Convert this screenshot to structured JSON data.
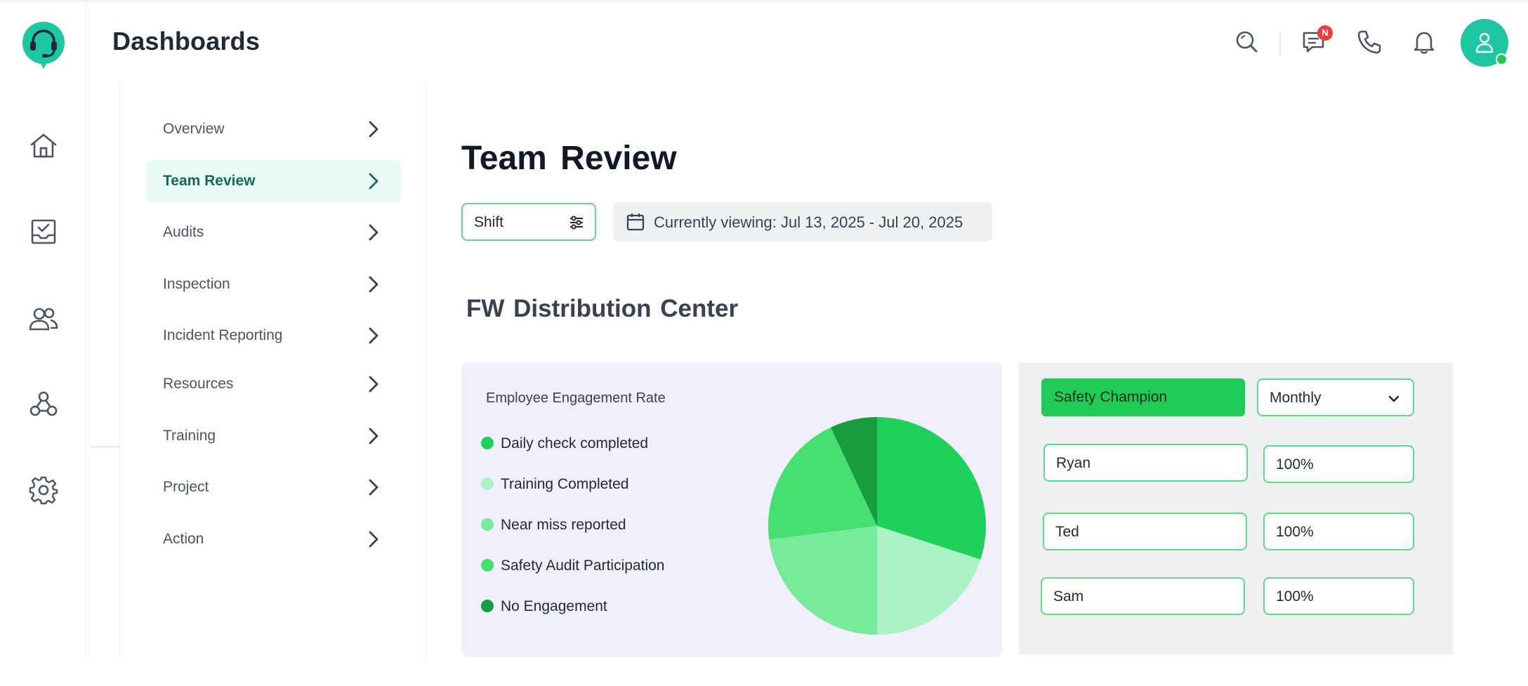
{
  "header": {
    "title": "Dashboards",
    "notification_badge": "N",
    "icons": [
      "headset-logo-icon",
      "search-icon",
      "chat-icon",
      "phone-icon",
      "bell-icon",
      "user-icon"
    ]
  },
  "rail": {
    "icons": [
      "home-icon",
      "inbox-check-icon",
      "users-icon",
      "workflow-icon",
      "gear-icon"
    ]
  },
  "subnav": {
    "items": [
      {
        "label": "Overview"
      },
      {
        "label": "Team Review"
      },
      {
        "label": "Audits"
      },
      {
        "label": "Inspection"
      },
      {
        "label": "Incident Reporting"
      },
      {
        "label": "Resources"
      },
      {
        "label": "Training"
      },
      {
        "label": "Project"
      },
      {
        "label": "Action"
      }
    ],
    "active": "Team Review"
  },
  "main": {
    "title": "Team Review",
    "shift_filter": "Shift",
    "date_range": "Currently viewing: Jul 13, 2025 - Jul 20, 2025",
    "section_title": "FW Distribution Center"
  },
  "chart_data": {
    "type": "pie",
    "title": "Employee Engagement Rate",
    "series": [
      {
        "name": "Daily check completed",
        "value": 30,
        "color": "#1fd15a"
      },
      {
        "name": "Training Completed",
        "value": 20,
        "color": "#adf2c4"
      },
      {
        "name": "Near miss reported",
        "value": 23,
        "color": "#78eb9a"
      },
      {
        "name": "Safety Audit Participation",
        "value": 20,
        "color": "#44e070"
      },
      {
        "name": "No Engagement",
        "value": 7,
        "color": "#189c3e"
      }
    ],
    "legend_position": "left"
  },
  "champions": {
    "label": "Safety Champion",
    "period": "Monthly",
    "rows": [
      {
        "name": "Ryan",
        "value": "100%"
      },
      {
        "name": "Ted",
        "value": "100%"
      },
      {
        "name": "Sam",
        "value": "100%"
      }
    ]
  },
  "colors": {
    "accent": "#1ec6a2",
    "green": "#1fcc58",
    "border_green": "#5fdb86"
  }
}
